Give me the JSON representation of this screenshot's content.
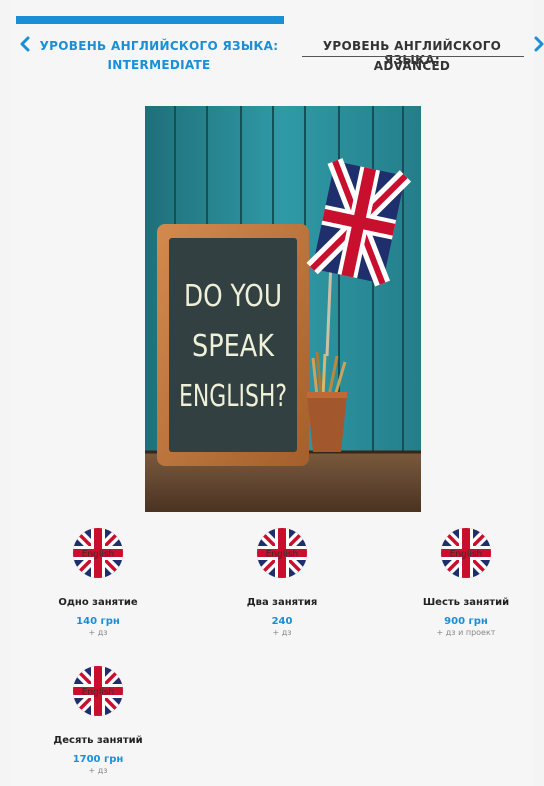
{
  "nav": {
    "prev": {
      "line1": "УРОВЕНЬ АНГЛИЙСКОГО ЯЗЫКА:",
      "line2": "INTERMEDIATE"
    },
    "next": {
      "line1": "УРОВЕНЬ АНГЛИЙСКОГО ЯЗЫКА:",
      "line2": "ADVANCED"
    }
  },
  "hero": {
    "board_lines": [
      "DO YOU",
      "SPEAK",
      "ENGLISH?"
    ]
  },
  "products": [
    {
      "name": "Одно занятие",
      "price": "140 грн",
      "note": "+ дз",
      "badge_label": "English"
    },
    {
      "name": "Два занятия",
      "price": "240",
      "note": "+ дз",
      "badge_label": "English"
    },
    {
      "name": "Шесть занятий",
      "price": "900 грн",
      "note": "+ дз и проект",
      "badge_label": "English"
    },
    {
      "name": "Десять занятий",
      "price": "1700 грн",
      "note": "+ дз",
      "badge_label": "English"
    }
  ],
  "colors": {
    "accent": "#1a8fd6",
    "background": "#f6f6f6",
    "text": "#222222"
  }
}
